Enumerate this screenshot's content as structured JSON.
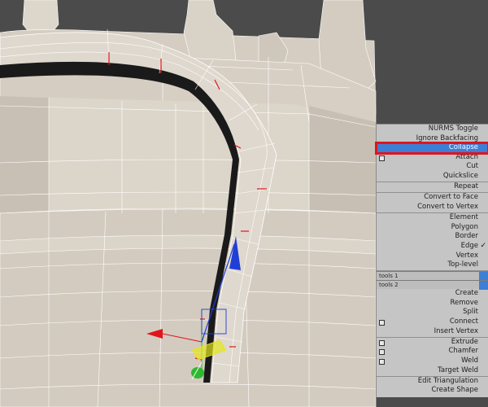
{
  "menu": {
    "groups": [
      [
        {
          "label": "NURMS Toggle"
        },
        {
          "label": "Ignore Backfacing"
        },
        {
          "label": "Collapse",
          "selected": true
        },
        {
          "label": "Attach",
          "has_settings": true
        },
        {
          "label": "Cut"
        },
        {
          "label": "Quickslice"
        }
      ],
      [
        {
          "label": "Repeat"
        }
      ],
      [
        {
          "label": "Convert to Face"
        },
        {
          "label": "Convert to Vertex"
        }
      ],
      [
        {
          "label": "Element"
        },
        {
          "label": "Polygon"
        },
        {
          "label": "Border"
        },
        {
          "label": "Edge",
          "checked": true
        },
        {
          "label": "Vertex"
        },
        {
          "label": "Top-level"
        }
      ],
      [
        {
          "label": "Create"
        },
        {
          "label": "Remove"
        },
        {
          "label": "Split"
        },
        {
          "label": "Connect",
          "has_settings": true
        },
        {
          "label": "Insert Vertex"
        }
      ],
      [
        {
          "label": "Extrude",
          "has_settings": true
        },
        {
          "label": "Chamfer",
          "has_settings": true
        },
        {
          "label": "Weld",
          "has_settings": true
        },
        {
          "label": "Target Weld"
        }
      ],
      [
        {
          "label": "Edit Triangulation"
        },
        {
          "label": "Create Shape"
        }
      ]
    ],
    "tools": [
      {
        "label": "tools 1"
      },
      {
        "label": "tools 2"
      }
    ],
    "check_glyph": "✓",
    "selected_outline_color": "#e0141c",
    "highlight_color": "#3d7fd6"
  },
  "viewport": {
    "background": "#4b4b4b",
    "model_color": "#d9d2c7",
    "edge_selection_color": "#e0141c",
    "gizmo": {
      "x_color": "#e0141c",
      "y_color": "#2fb82f",
      "z_color": "#1f3fd6",
      "plane_color": "#e6e61e"
    }
  }
}
